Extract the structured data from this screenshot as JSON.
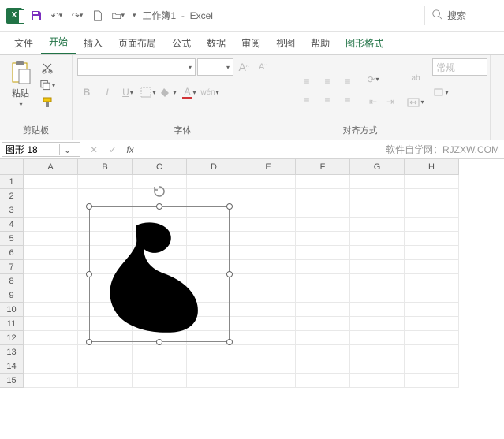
{
  "app": {
    "title_doc": "工作簿1",
    "title_app": "Excel",
    "search_placeholder": "搜索"
  },
  "qat": {
    "save": "保存",
    "undo": "撤销",
    "redo": "重做",
    "new": "新建",
    "open": "打开"
  },
  "tabs": {
    "file": "文件",
    "home": "开始",
    "insert": "插入",
    "page_layout": "页面布局",
    "formulas": "公式",
    "data": "数据",
    "review": "审阅",
    "view": "视图",
    "help": "帮助",
    "shape_format": "图形格式"
  },
  "ribbon": {
    "clipboard": {
      "label": "剪贴板",
      "paste": "粘贴"
    },
    "font": {
      "label": "字体",
      "bold": "B",
      "italic": "I",
      "underline": "U",
      "grow": "A",
      "shrink": "A",
      "wen": "wén",
      "font_color_accent": "#d13438",
      "fill_color_accent": "#f2c80f"
    },
    "alignment": {
      "label": "对齐方式",
      "wrap": "ab",
      "general": "常规"
    }
  },
  "namebox": {
    "value": "图形 18"
  },
  "fx": {
    "watermark": "软件自学网：RJZXW.COM"
  },
  "grid": {
    "columns": [
      "A",
      "B",
      "C",
      "D",
      "E",
      "F",
      "G",
      "H"
    ],
    "row_count": 15
  },
  "shape": {
    "name": "muscle-arm-shape",
    "fill": "#000000"
  }
}
